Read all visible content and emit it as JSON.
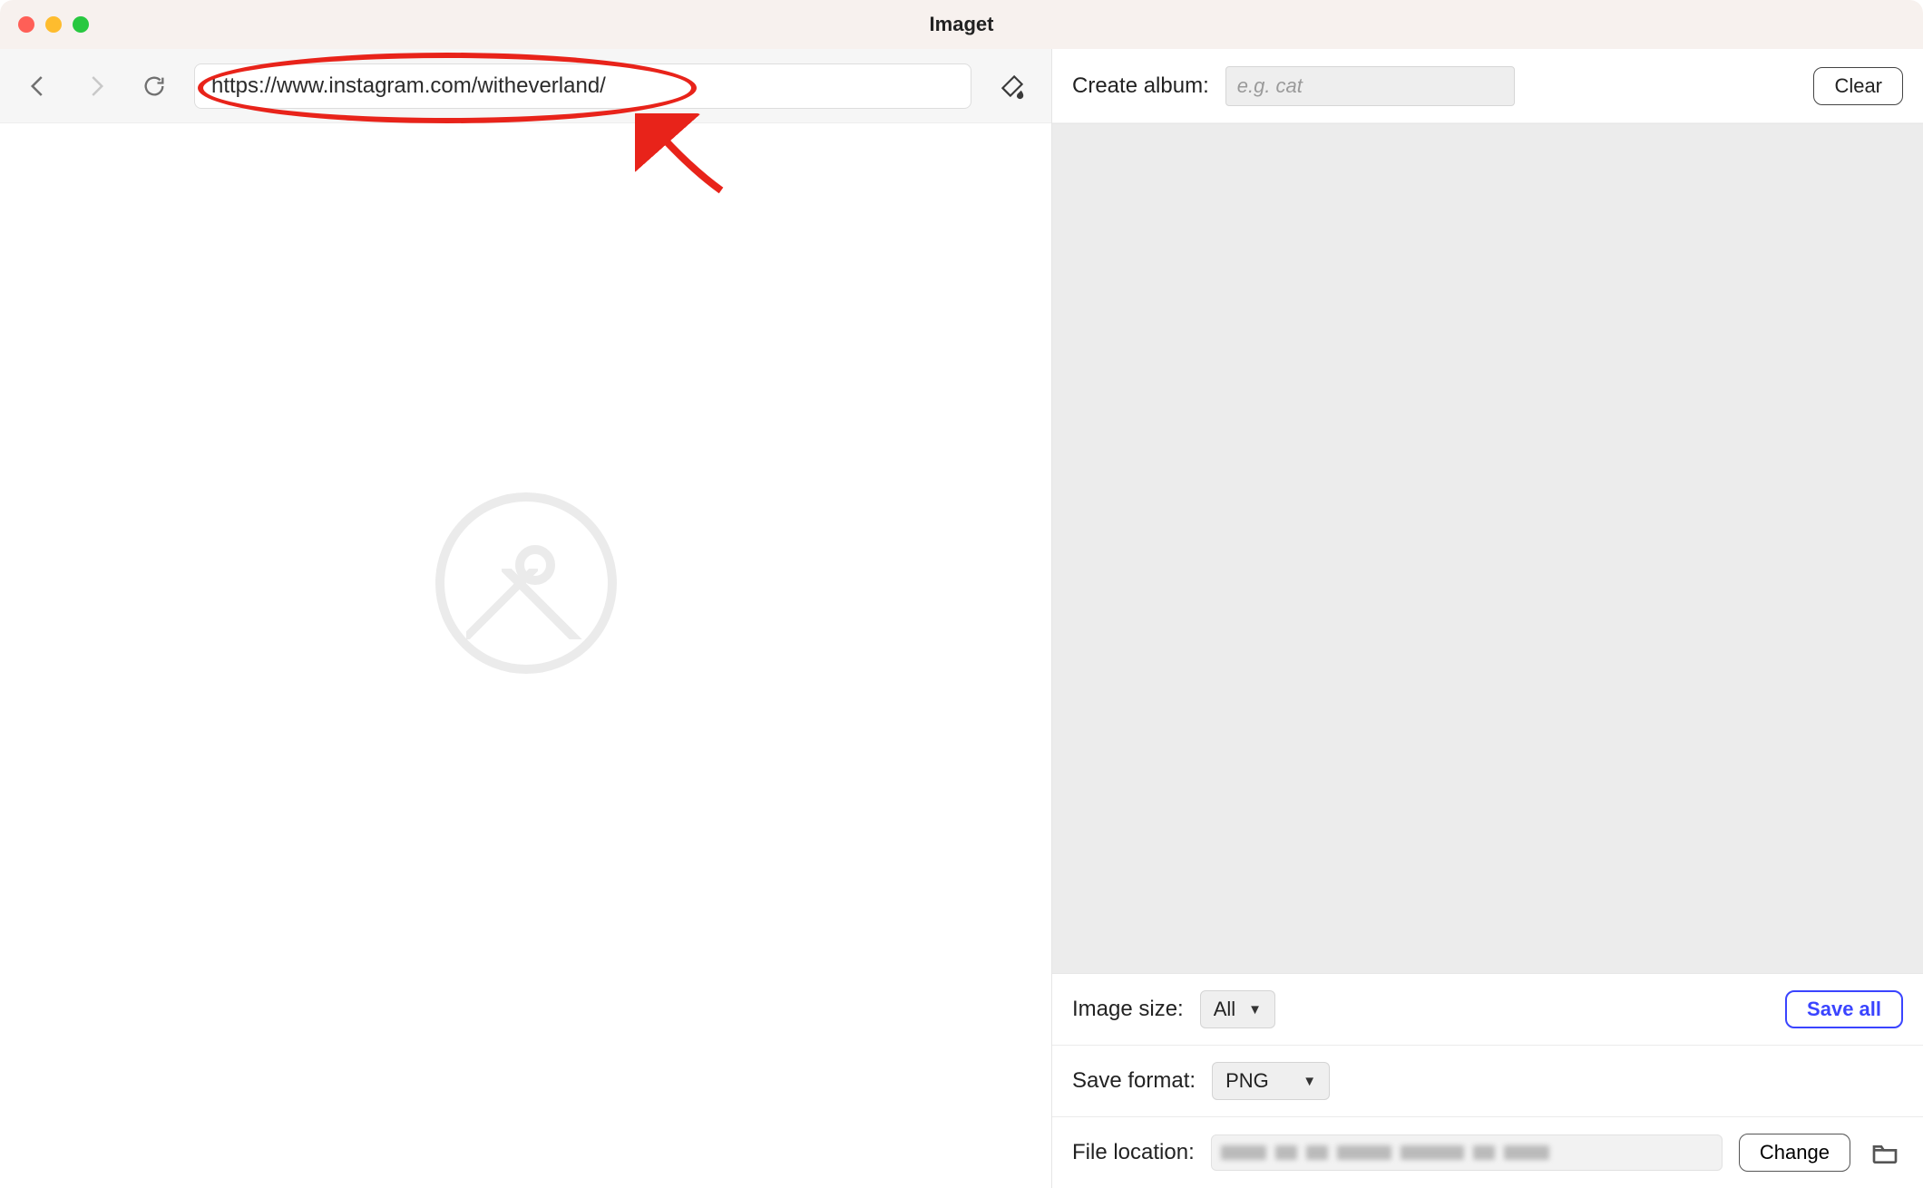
{
  "window": {
    "title": "Imaget"
  },
  "nav": {
    "url_value": "https://www.instagram.com/witheverland/"
  },
  "right": {
    "create_album_label": "Create album:",
    "album_placeholder": "e.g. cat",
    "clear_label": "Clear",
    "image_size_label": "Image size:",
    "image_size_value": "All",
    "save_all_label": "Save all",
    "save_format_label": "Save format:",
    "save_format_value": "PNG",
    "file_location_label": "File location:",
    "change_label": "Change"
  }
}
